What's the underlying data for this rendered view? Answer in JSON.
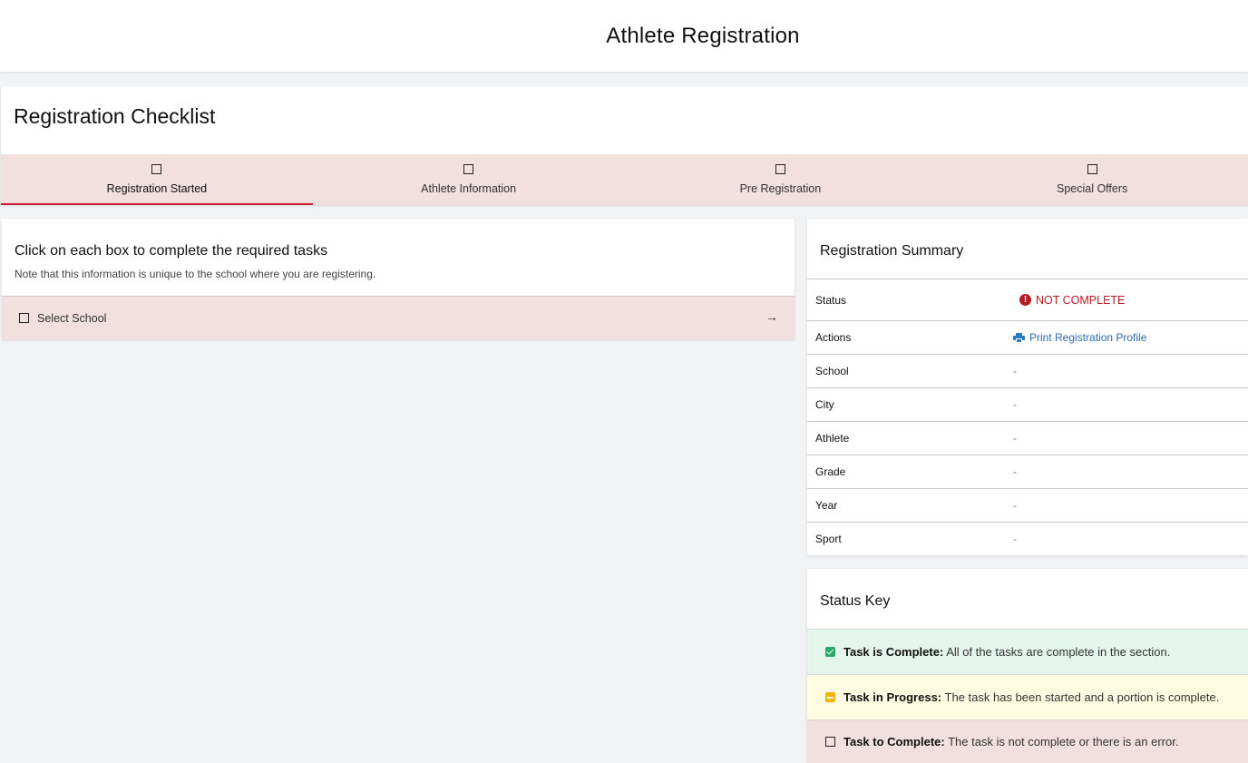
{
  "header": {
    "title": "Athlete Registration"
  },
  "checklist": {
    "title": "Registration Checklist",
    "steps": [
      {
        "label": "Registration Started",
        "active": true
      },
      {
        "label": "Athlete Information",
        "active": false
      },
      {
        "label": "Pre Registration",
        "active": false
      },
      {
        "label": "Special Offers",
        "active": false
      }
    ]
  },
  "tasks": {
    "title": "Click on each box to complete the required tasks",
    "note": "Note that this information is unique to the school where you are registering.",
    "items": [
      {
        "label": "Select School",
        "arrow": "→"
      }
    ]
  },
  "summary": {
    "title": "Registration Summary",
    "rows": [
      {
        "key": "Status",
        "value": "NOT COMPLETE"
      },
      {
        "key": "Actions",
        "value": "Print Registration Profile"
      },
      {
        "key": "School",
        "value": "-"
      },
      {
        "key": "City",
        "value": "-"
      },
      {
        "key": "Athlete",
        "value": "-"
      },
      {
        "key": "Grade",
        "value": "-"
      },
      {
        "key": "Year",
        "value": "-"
      },
      {
        "key": "Sport",
        "value": "-"
      }
    ],
    "status_icon": "!"
  },
  "status_key": {
    "title": "Status Key",
    "items": [
      {
        "label": "Task is Complete:",
        "desc": "All of the tasks are complete in the section."
      },
      {
        "label": "Task in Progress:",
        "desc": "The task has been started and a portion is complete."
      },
      {
        "label": "Task to Complete:",
        "desc": "The task is not complete or there is an error."
      }
    ]
  },
  "colors": {
    "accent": "#cc1f2f",
    "step_bg": "#f2dfe0",
    "complete_bg": "#e4f5ec",
    "progress_bg": "#fefce0",
    "link": "#2a6db0"
  }
}
